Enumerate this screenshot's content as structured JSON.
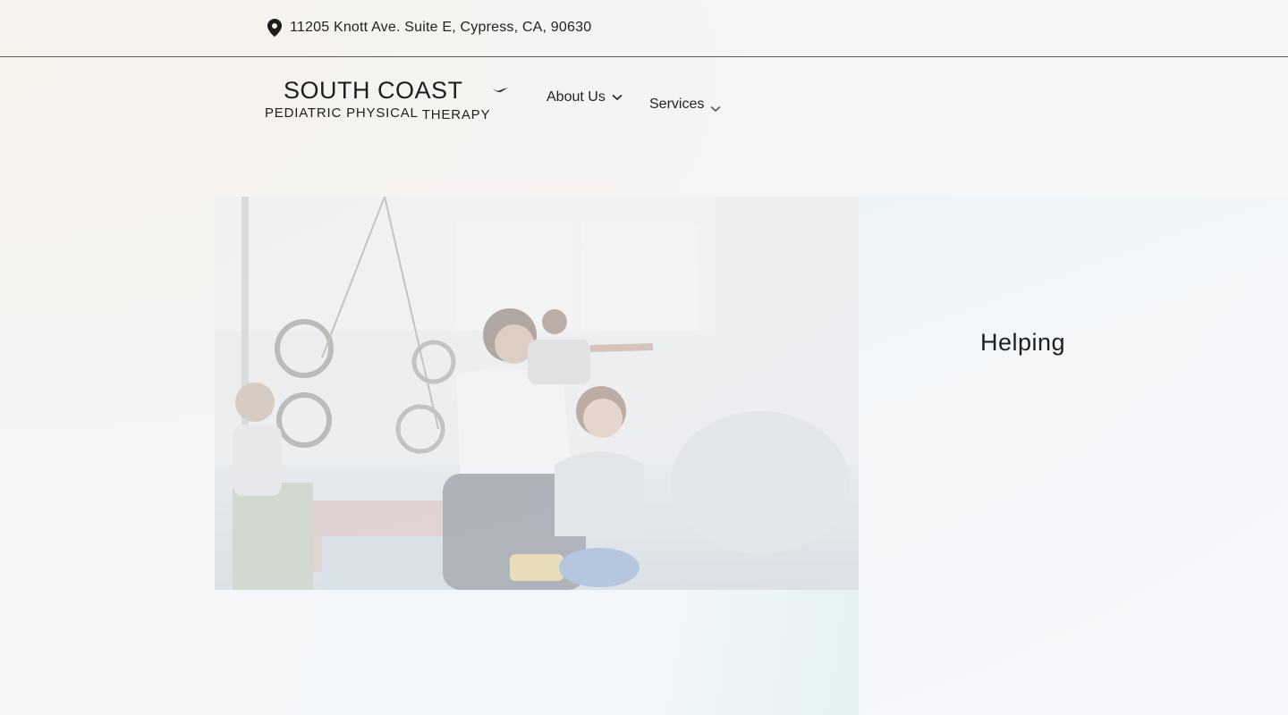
{
  "topbar": {
    "address": "11205 Knott Ave. Suite E, Cypress, CA, 90630",
    "address_icon": "location-pin-icon"
  },
  "logo": {
    "line1": "SOUTH COAST",
    "line2_word1": "PEDIATRIC",
    "line2_word2": "PHYSICAL",
    "line2_word3": "THERAPY",
    "icon": "bird-icon"
  },
  "nav": {
    "items": [
      {
        "label": "About Us",
        "icon": "chevron-down-icon"
      },
      {
        "label": "Services",
        "icon": "chevron-down-icon"
      }
    ]
  },
  "hero": {
    "heading": "Helping",
    "image": "therapist-with-child-in-gym-photo"
  },
  "colors": {
    "text": "#1f1f1f",
    "background": "#f5f7fa",
    "divider": "#5a5a5a"
  }
}
